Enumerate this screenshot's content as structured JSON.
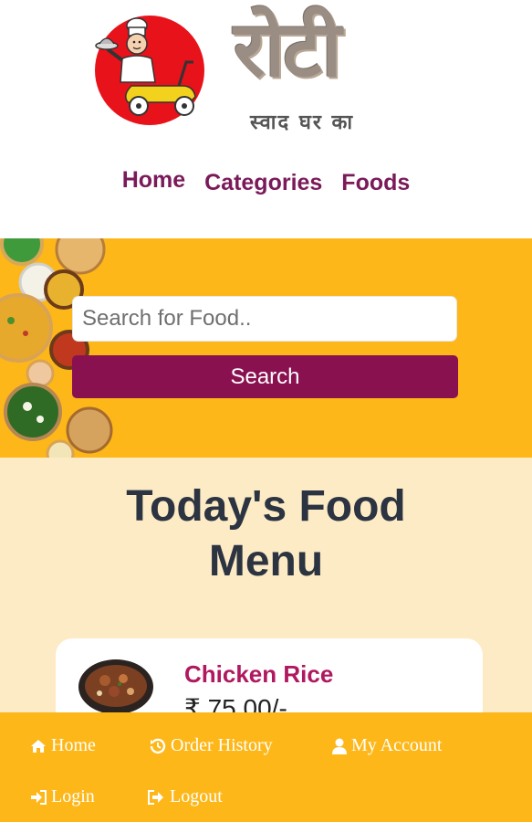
{
  "brand": {
    "name": "रोटी",
    "tagline": "स्वाद घर का"
  },
  "nav": {
    "items": [
      {
        "label": "Home"
      },
      {
        "label": "Categories"
      },
      {
        "label": "Foods"
      }
    ]
  },
  "search": {
    "placeholder": "Search for Food..",
    "button_label": "Search"
  },
  "menu": {
    "title_line1": "Today's Food",
    "title_line2": "Menu",
    "items": [
      {
        "name": "Chicken Rice",
        "price": "₹ 75.00/-"
      }
    ]
  },
  "bottom_nav": {
    "home": "Home",
    "order_history": "Order History",
    "my_account": "My Account",
    "login": "Login",
    "logout": "Logout"
  },
  "colors": {
    "accent": "#fdb719",
    "brand": "#8a1150",
    "nav_text": "#7a1a5a",
    "section_bg": "#fdebc6",
    "title_text": "#2c3441",
    "logo_red": "#e8121b"
  }
}
